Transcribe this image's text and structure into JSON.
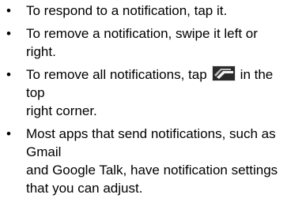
{
  "instructions": {
    "bullet_glyph": "•",
    "items": [
      {
        "lines": [
          "To respond to a notification, tap it."
        ]
      },
      {
        "lines": [
          "To remove a notification, swipe it left or",
          "right."
        ]
      },
      {
        "lines_before_icon": "To remove all notifications, tap",
        "icon": "clear-all-notifications-icon",
        "lines_after_icon": "in the",
        "lines": [
          "top",
          "right corner."
        ]
      },
      {
        "lines": [
          "Most apps that send notifications, such as",
          "Gmail",
          "and Google Talk, have notification settings",
          "that you can adjust."
        ]
      }
    ]
  },
  "colors": {
    "text": "#000000",
    "icon_dark": "#1a1a1a",
    "icon_light": "#e0e0e0"
  }
}
